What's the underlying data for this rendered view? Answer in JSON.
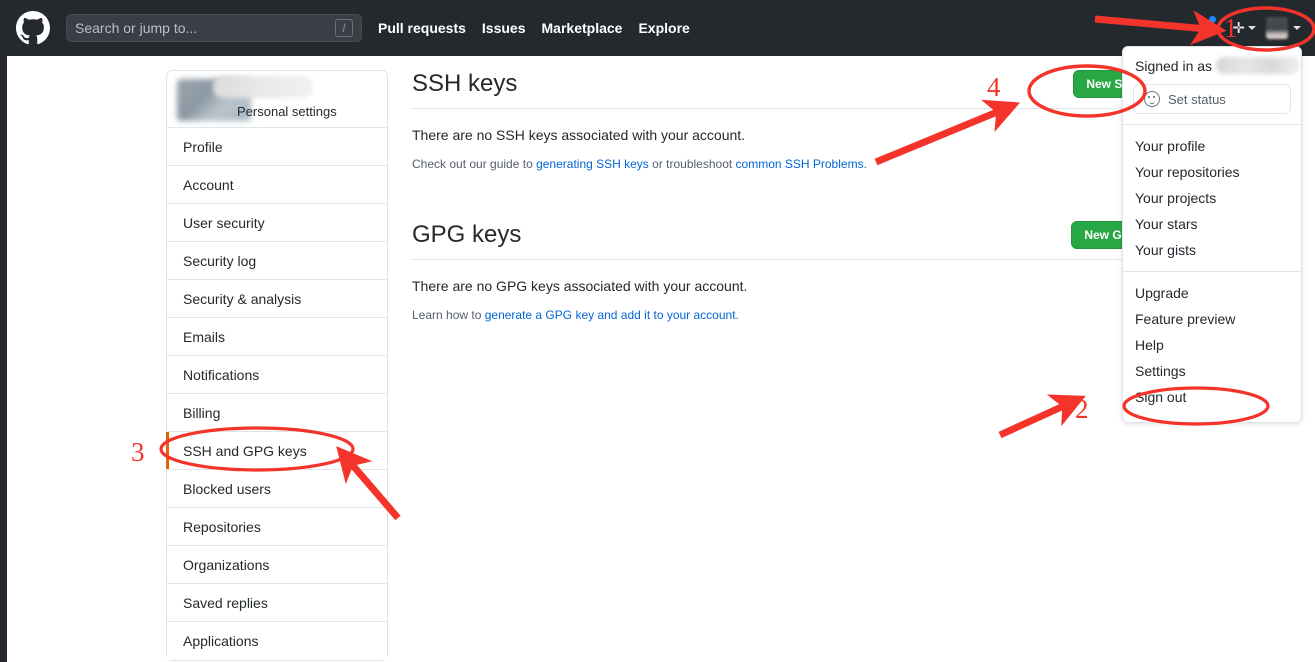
{
  "header": {
    "logo_icon": "github-mark-icon",
    "search": {
      "placeholder": "Search or jump to...",
      "value": "",
      "shortcut_key": "/"
    },
    "nav": [
      {
        "label": "Pull requests"
      },
      {
        "label": "Issues"
      },
      {
        "label": "Marketplace"
      },
      {
        "label": "Explore"
      }
    ],
    "notifications_icon": "bell-icon",
    "create_new_icon": "plus-icon",
    "avatar_label": "user-avatar",
    "background_color": "#24292e"
  },
  "sidebar": {
    "header_label": "Personal settings",
    "active_item": "SSH and GPG keys",
    "active_marker_color": "#e36209",
    "items": [
      {
        "label": "Profile"
      },
      {
        "label": "Account"
      },
      {
        "label": "User security"
      },
      {
        "label": "Security log"
      },
      {
        "label": "Security & analysis"
      },
      {
        "label": "Emails"
      },
      {
        "label": "Notifications"
      },
      {
        "label": "Billing"
      },
      {
        "label": "SSH and GPG keys"
      },
      {
        "label": "Blocked users"
      },
      {
        "label": "Repositories"
      },
      {
        "label": "Organizations"
      },
      {
        "label": "Saved replies"
      },
      {
        "label": "Applications"
      }
    ]
  },
  "main": {
    "ssh": {
      "title": "SSH keys",
      "button_label": "New SSH",
      "empty_text": "There are no SSH keys associated with your account.",
      "help_prefix": "Check out our guide to ",
      "help_link1": "generating SSH keys",
      "help_middle": " or troubleshoot ",
      "help_link2": "common SSH Problems",
      "help_suffix": "."
    },
    "gpg": {
      "title": "GPG keys",
      "button_label": "New GPG",
      "empty_text": "There are no GPG keys associated with your account.",
      "help_prefix": "Learn how to ",
      "help_link1": "generate a GPG key and add it to your account",
      "help_suffix": "."
    },
    "button_color": "#28a745",
    "link_color": "#0366d6"
  },
  "user_dropdown": {
    "signed_in_label": "Signed in as",
    "signed_in_user": "",
    "set_status_label": "Set status",
    "set_status_icon": "smiley-icon",
    "group1": [
      {
        "label": "Your profile"
      },
      {
        "label": "Your repositories"
      },
      {
        "label": "Your projects"
      },
      {
        "label": "Your stars"
      },
      {
        "label": "Your gists"
      }
    ],
    "group2": [
      {
        "label": "Upgrade"
      },
      {
        "label": "Feature preview"
      },
      {
        "label": "Help"
      },
      {
        "label": "Settings"
      },
      {
        "label": "Sign out"
      }
    ]
  },
  "annotations": {
    "color": "#f4342a",
    "steps": [
      {
        "number": "1",
        "target": "avatar-dropdown-toggle"
      },
      {
        "number": "2",
        "target": "dropdown-item-settings"
      },
      {
        "number": "3",
        "target": "sidebar-item-ssh-and-gpg-keys"
      },
      {
        "number": "4",
        "target": "new-ssh-button"
      }
    ]
  }
}
